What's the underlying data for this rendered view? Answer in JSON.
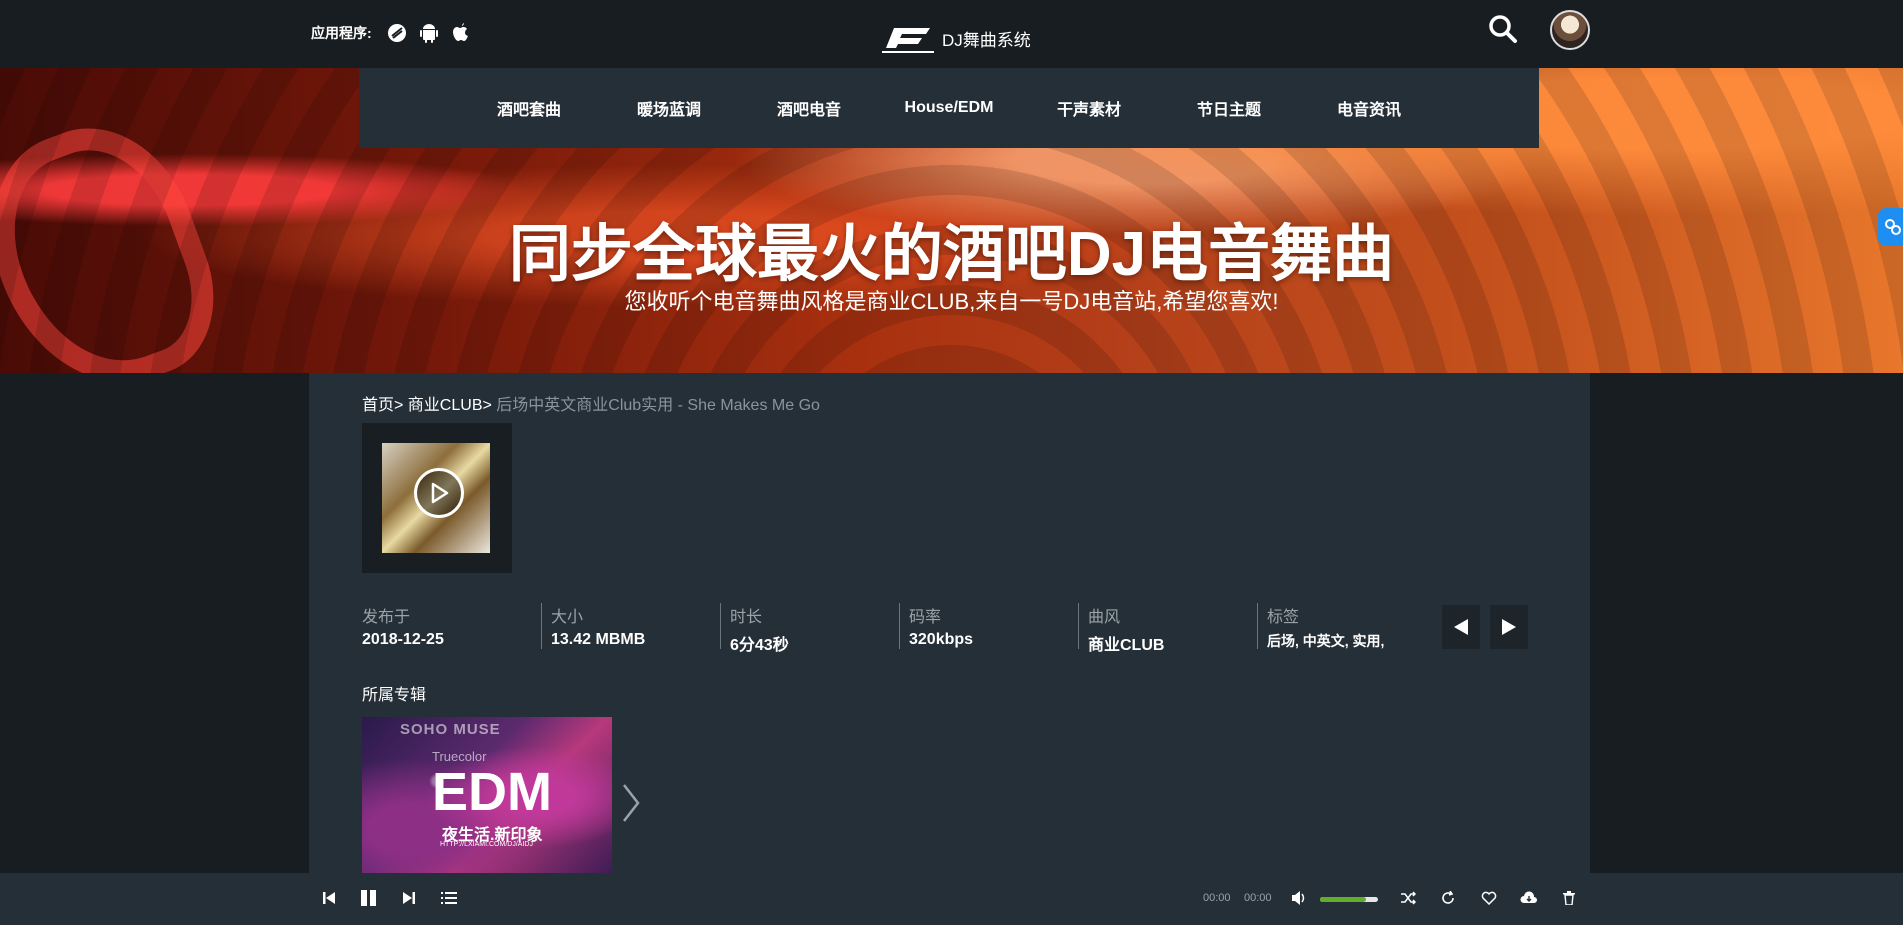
{
  "header": {
    "apps_label": "应用程序:",
    "logo_text": "DJ舞曲系统",
    "icons": [
      "browser-icon",
      "android-icon",
      "apple-icon",
      "search-icon",
      "avatar"
    ]
  },
  "nav": {
    "items": [
      "酒吧套曲",
      "暖场蓝调",
      "酒吧电音",
      "House/EDM",
      "干声素材",
      "节日主题",
      "电音资讯"
    ]
  },
  "banner": {
    "title": "同步全球最火的酒吧DJ电音舞曲",
    "subtitle": "您收听个电音舞曲风格是商业CLUB,来自一号DJ电音站,希望您喜欢!"
  },
  "breadcrumb": {
    "home": "首页>",
    "category": " 商业CLUB>",
    "current": " 后场中英文商业Club实用 - She Makes Me Go"
  },
  "meta": [
    {
      "label": "发布于",
      "value": "2018-12-25"
    },
    {
      "label": "大小",
      "value": "13.42 MBMB"
    },
    {
      "label": "时长",
      "value": "6分43秒"
    },
    {
      "label": "码率",
      "value": "320kbps"
    },
    {
      "label": "曲风",
      "value": "商业CLUB"
    },
    {
      "label": "标签",
      "value": "后场, 中英文, 实用,"
    }
  ],
  "album": {
    "heading": "所属专辑",
    "cover_text": {
      "line1": "SOHO MUSE",
      "line2": "Truecolor",
      "line3": "EDM",
      "line4": "夜生活.新印象",
      "line5": "HTTP://LXIAMI.COM/DJ/AIDJ"
    }
  },
  "player": {
    "time_current": "00:00",
    "time_total": "00:00",
    "volume_percent": 80
  },
  "colors": {
    "background": "#171d21",
    "panel": "#252f37",
    "volume": "#62ad2b",
    "side_tab": "#1e8ff0"
  }
}
